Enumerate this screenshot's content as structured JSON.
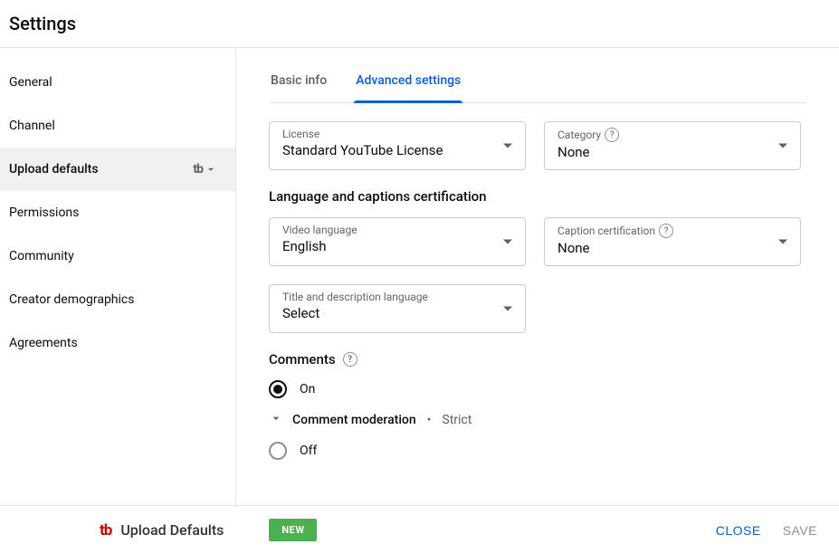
{
  "header": {
    "title": "Settings"
  },
  "sidebar": {
    "items": [
      {
        "label": "General"
      },
      {
        "label": "Channel"
      },
      {
        "label": "Upload defaults"
      },
      {
        "label": "Permissions"
      },
      {
        "label": "Community"
      },
      {
        "label": "Creator demographics"
      },
      {
        "label": "Agreements"
      }
    ]
  },
  "tabs": {
    "basic": "Basic info",
    "advanced": "Advanced settings"
  },
  "license": {
    "label": "License",
    "value": "Standard YouTube License"
  },
  "category": {
    "label": "Category",
    "value": "None"
  },
  "section_lang_caption": "Language and captions certification",
  "video_language": {
    "label": "Video language",
    "value": "English"
  },
  "caption_cert": {
    "label": "Caption certification",
    "value": "None"
  },
  "title_lang": {
    "label": "Title and description language",
    "value": "Select"
  },
  "comments": {
    "title": "Comments",
    "on": "On",
    "off": "Off",
    "moderation_label": "Comment moderation",
    "moderation_value": "Strict"
  },
  "footer": {
    "brand": "Upload Defaults",
    "new": "NEW",
    "close": "CLOSE",
    "save": "SAVE"
  }
}
